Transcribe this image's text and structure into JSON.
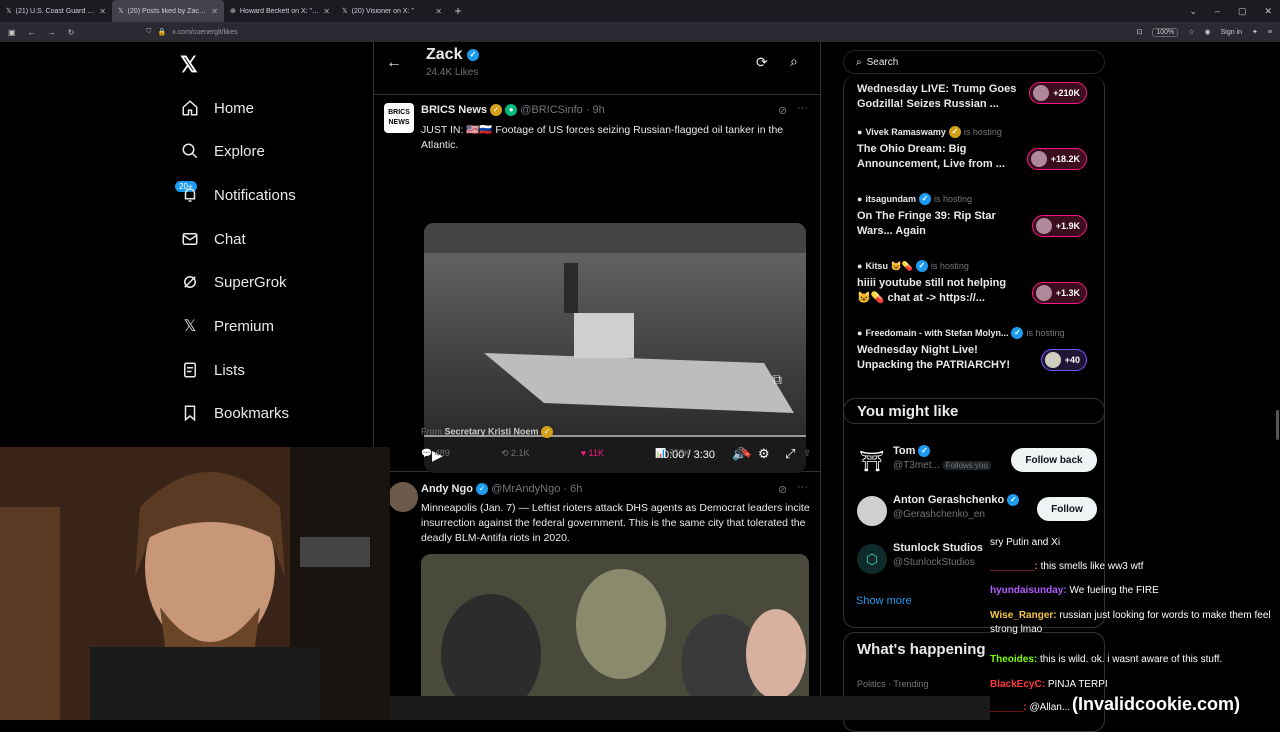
{
  "browser": {
    "tabs": [
      {
        "label": "(21) U.S. Coast Guard Seizes Ta",
        "active": false
      },
      {
        "label": "(20) Posts liked by Zack (@bsr",
        "active": true
      },
      {
        "label": "Howard Beckett on X: \"You",
        "active": false
      },
      {
        "label": "(20) Visioner on X: \"",
        "active": false
      }
    ],
    "url": "x.com/cuenerglt/likes",
    "zoom": "100%",
    "signin": "Sign in"
  },
  "nav": {
    "items": [
      {
        "label": "Home",
        "icon": "home-icon"
      },
      {
        "label": "Explore",
        "icon": "search-icon"
      },
      {
        "label": "Notifications",
        "icon": "bell-icon"
      },
      {
        "label": "Chat",
        "icon": "mail-icon"
      },
      {
        "label": "SuperGrok",
        "icon": "grok-icon"
      },
      {
        "label": "Premium",
        "icon": "x-icon"
      },
      {
        "label": "Lists",
        "icon": "list-icon"
      },
      {
        "label": "Bookmarks",
        "icon": "bookmark-icon"
      }
    ],
    "notif_badge": "20+"
  },
  "profile_header": {
    "name": "Zack",
    "likes": "24.4K Likes"
  },
  "tweets": [
    {
      "author": "BRICS News",
      "handle": "@BRICSinfo",
      "time": "· 9h",
      "text": "JUST IN: 🇺🇸🇷🇺 Footage of US forces seizing Russian-flagged oil tanker in the Atlantic.",
      "video_time": "0:00 / 3:30",
      "from_label": "From",
      "from_name": "Secretary Kristi Noem",
      "replies": "489",
      "retweets": "2.1K",
      "likes": "11K",
      "views": "778K"
    },
    {
      "author": "Andy Ngo",
      "handle": "@MrAndyNgo",
      "time": "· 6h",
      "text": "Minneapolis (Jan. 7) — Leftist rioters attack DHS agents as Democrat leaders incite insurrection against the federal government. This is the same city that tolerated the deadly BLM-Antifa riots in 2020."
    }
  ],
  "right": {
    "search_placeholder": "Search",
    "spaces": [
      {
        "host": "",
        "status": "",
        "title": "Wednesday LIVE: Trump Goes Godzilla! Seizes Russian ...",
        "count": "+210K",
        "pill": "pink"
      },
      {
        "host": "Vivek Ramaswamy",
        "status": "is hosting",
        "title": "The Ohio Dream: Big Announcement, Live from ...",
        "count": "+18.2K",
        "pill": "pink"
      },
      {
        "host": "itsagundam",
        "status": "is hosting",
        "title": "On The Fringe 39: Rip Star Wars... Again",
        "count": "+1.9K",
        "pill": "pink"
      },
      {
        "host": "Kitsu 😺💊",
        "status": "is hosting",
        "title": "hiiii youtube still not helping 😺💊 chat at -> https://...",
        "count": "+1.3K",
        "pill": "pink"
      },
      {
        "host": "Freedomain - with Stefan Molyn...",
        "status": "is hosting",
        "title": "Wednesday Night Live! Unpacking the PATRIARCHY!",
        "count": "+40",
        "pill": "purple"
      }
    ],
    "you_might_like": "You might like",
    "follow_suggestions": [
      {
        "name": "Tom",
        "handle": "@T3met...",
        "follows_you": "Follows you",
        "button": "Follow back"
      },
      {
        "name": "Anton Gerashchenko",
        "handle": "@Gerashchenko_en",
        "follows_you": "",
        "button": "Follow"
      },
      {
        "name": "Stunlock Studios",
        "handle": "@StunlockStudios",
        "follows_you": "",
        "button": ""
      }
    ],
    "show_more": "Show more",
    "whats_happening": "What's happening",
    "trend_category": "Politics · Trending"
  },
  "chat": [
    {
      "user": "",
      "msg": "sry Putin and Xi",
      "color": "#ffffff"
    },
    {
      "user": "________:",
      "msg": "this smells like ww3 wtf",
      "color": "#ff4d6d"
    },
    {
      "user": "hyundaisunday:",
      "msg": "We fueling the FIRE",
      "color": "#b05cff"
    },
    {
      "user": "Wise_Ranger:",
      "msg": "russian just looking for words to make them feel strong lmao",
      "color": "#f5c542"
    },
    {
      "user": "Theoides:",
      "msg": "this is wild. ok. i wasnt aware of this stuff.",
      "color": "#7cfc00"
    },
    {
      "user": "BlackEcyC:",
      "msg": "PINJA TERPI",
      "color": "#ff3b3b"
    },
    {
      "user": "______:",
      "msg": "@Allan...",
      "color": "#ff3b3b"
    }
  ],
  "watermark": "(Invalidcookie.com)"
}
